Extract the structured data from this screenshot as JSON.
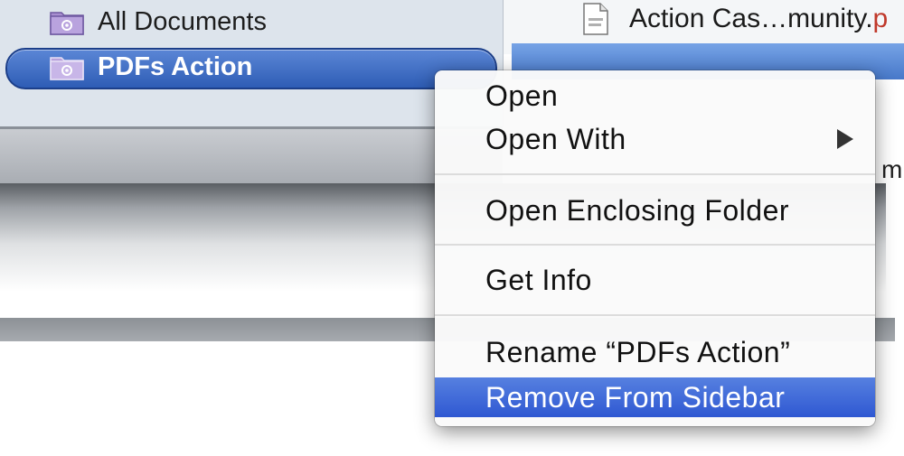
{
  "sidebar": {
    "items": [
      {
        "label": "All Documents",
        "icon": "smart-folder-icon",
        "selected": false
      },
      {
        "label": "PDFs Action",
        "icon": "smart-folder-icon",
        "selected": true
      }
    ]
  },
  "file_list": {
    "visible_item": {
      "label": "Action Cas…munity.",
      "ext": "p",
      "icon": "document-icon"
    },
    "partial_text": "m"
  },
  "context_menu": {
    "items": [
      {
        "label": "Open",
        "has_submenu": false,
        "highlighted": false
      },
      {
        "label": "Open With",
        "has_submenu": true,
        "highlighted": false
      },
      {
        "label": "Open Enclosing Folder",
        "has_submenu": false,
        "highlighted": false
      },
      {
        "label": "Get Info",
        "has_submenu": false,
        "highlighted": false
      },
      {
        "label": "Rename “PDFs Action”",
        "has_submenu": false,
        "highlighted": false
      },
      {
        "label": "Remove From Sidebar",
        "has_submenu": false,
        "highlighted": true
      }
    ],
    "highlight_color": "#2f58d2"
  },
  "colors": {
    "sidebar_bg": "#dde4ec",
    "selection": "#2e5db5"
  }
}
